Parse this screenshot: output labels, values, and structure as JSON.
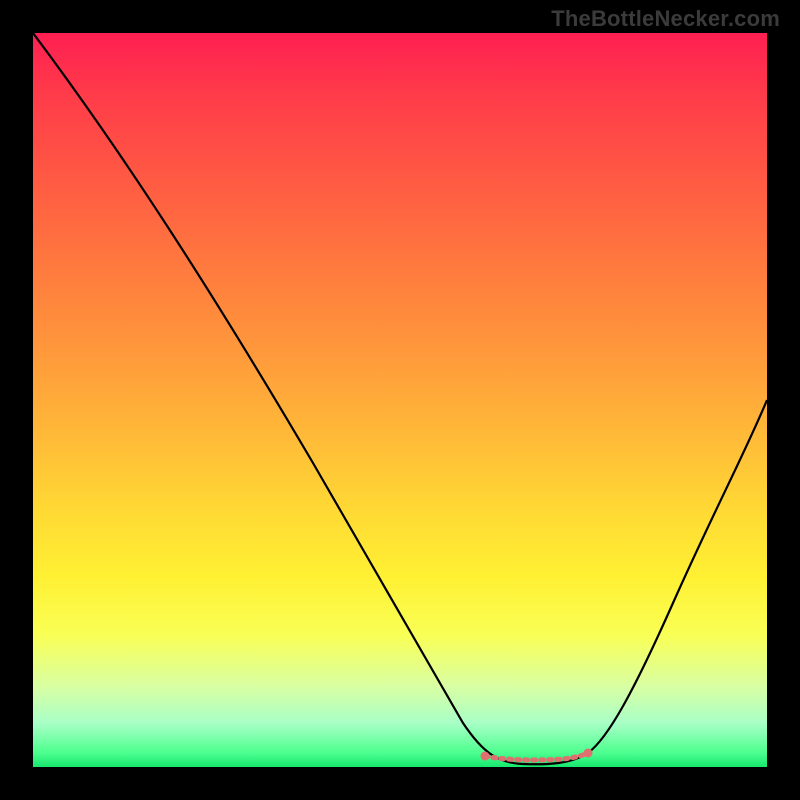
{
  "watermark": "TheBottleNecker.com",
  "chart_data": {
    "type": "line",
    "title": "",
    "xlabel": "",
    "ylabel": "",
    "x": [
      0.0,
      0.05,
      0.1,
      0.15,
      0.2,
      0.25,
      0.3,
      0.35,
      0.4,
      0.45,
      0.5,
      0.55,
      0.57,
      0.6,
      0.63,
      0.66,
      0.7,
      0.74,
      0.76,
      0.8,
      0.85,
      0.9,
      0.95,
      1.0
    ],
    "values": [
      1.0,
      0.94,
      0.85,
      0.76,
      0.67,
      0.58,
      0.5,
      0.42,
      0.35,
      0.28,
      0.21,
      0.13,
      0.08,
      0.04,
      0.02,
      0.01,
      0.01,
      0.02,
      0.04,
      0.09,
      0.18,
      0.28,
      0.39,
      0.5
    ],
    "minimum_plateau_x": [
      0.63,
      0.74
    ],
    "minimum_plateau_y": 0.015,
    "xlim": [
      0,
      1
    ],
    "ylim": [
      0,
      1
    ],
    "gradient_stops": [
      {
        "pos": 0.0,
        "color": "#ff1f52"
      },
      {
        "pos": 0.5,
        "color": "#ffba38"
      },
      {
        "pos": 0.8,
        "color": "#fff033"
      },
      {
        "pos": 1.0,
        "color": "#17e86f"
      }
    ],
    "curve_color": "#000000",
    "marker_color": "#e07070"
  }
}
